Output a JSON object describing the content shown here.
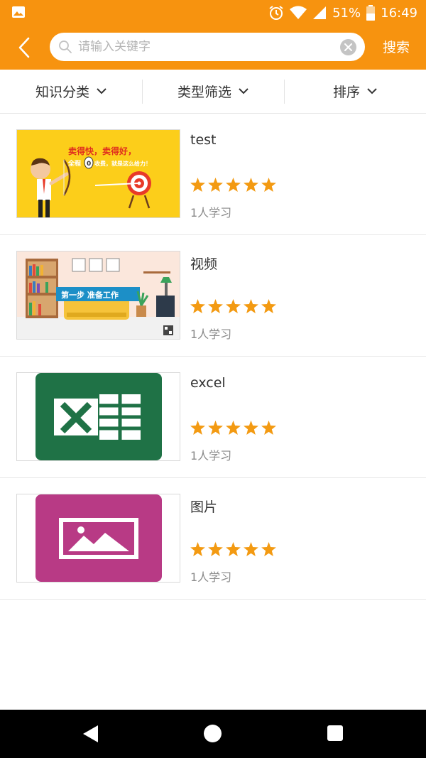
{
  "status_bar": {
    "battery": "51%",
    "time": "16:49",
    "icons": [
      "image-notification-icon",
      "alarm-icon",
      "wifi-icon",
      "signal-icon",
      "battery-icon"
    ]
  },
  "header": {
    "back_icon": "chevron-left-icon",
    "search": {
      "placeholder": "请输入关键字",
      "value": ""
    },
    "search_button_label": "搜索"
  },
  "filters": [
    {
      "label": "知识分类"
    },
    {
      "label": "类型筛选"
    },
    {
      "label": "排序"
    }
  ],
  "courses": [
    {
      "title": "test",
      "rating": 5,
      "learners": "1人学习",
      "thumbnail_text": [
        "卖得快，卖得好，",
        "全程",
        "0",
        "收费，就是这么给力！"
      ]
    },
    {
      "title": "视频",
      "rating": 5,
      "learners": "1人学习",
      "thumbnail_text": [
        "第一步  准备工作"
      ]
    },
    {
      "title": "excel",
      "rating": 5,
      "learners": "1人学习",
      "thumbnail_text": []
    },
    {
      "title": "图片",
      "rating": 5,
      "learners": "1人学习",
      "thumbnail_text": []
    }
  ],
  "nav_bar": {
    "icons": [
      "back-triangle-icon",
      "home-circle-icon",
      "recents-square-icon"
    ]
  },
  "colors": {
    "brand_orange": "#f7930f",
    "star": "#f39a12",
    "excel_green": "#1f7246",
    "image_magenta": "#b83a85"
  }
}
